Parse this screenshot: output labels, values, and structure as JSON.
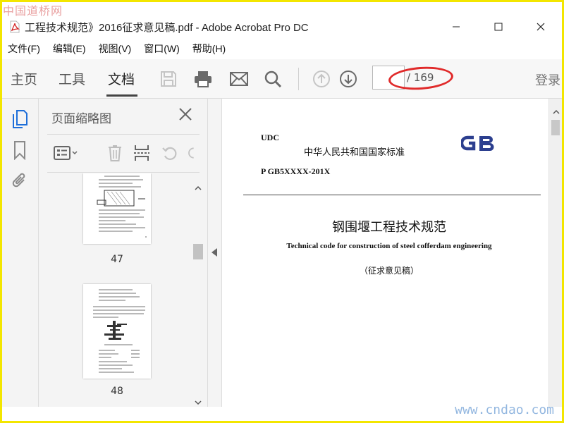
{
  "watermarks": {
    "top": "中国道桥网",
    "bottom": "www.cndao.com"
  },
  "window": {
    "title": "工程技术规范》2016征求意见稿.pdf - Adobe Acrobat Pro DC",
    "minimize": "—",
    "maximize": "☐",
    "close": "✕"
  },
  "menu": {
    "items": [
      "文件(F)",
      "编辑(E)",
      "视图(V)",
      "窗口(W)",
      "帮助(H)"
    ]
  },
  "toolbar": {
    "tabs": [
      "主页",
      "工具",
      "文档"
    ],
    "active_tab": "文档",
    "page_current": "",
    "page_total": "/ 169",
    "login": "登录"
  },
  "thumb_panel": {
    "title": "页面缩略图",
    "pages": [
      {
        "label": "47"
      },
      {
        "label": "48"
      }
    ]
  },
  "document": {
    "udc": "UDC",
    "national_standard": "中华人民共和国国家标准",
    "gb_code": "P GB5XXXX-201X",
    "logo_text": "GB",
    "title_cn": "钢围堰工程技术规范",
    "title_en": "Technical code for construction of steel cofferdam engineering",
    "draft_note": "（征求意见稿）"
  },
  "colors": {
    "accent_blue": "#1e6fd9",
    "annotation_red": "#e02a2a",
    "frame_yellow": "#f3e600",
    "gb_logo": "#2c3f8f"
  }
}
